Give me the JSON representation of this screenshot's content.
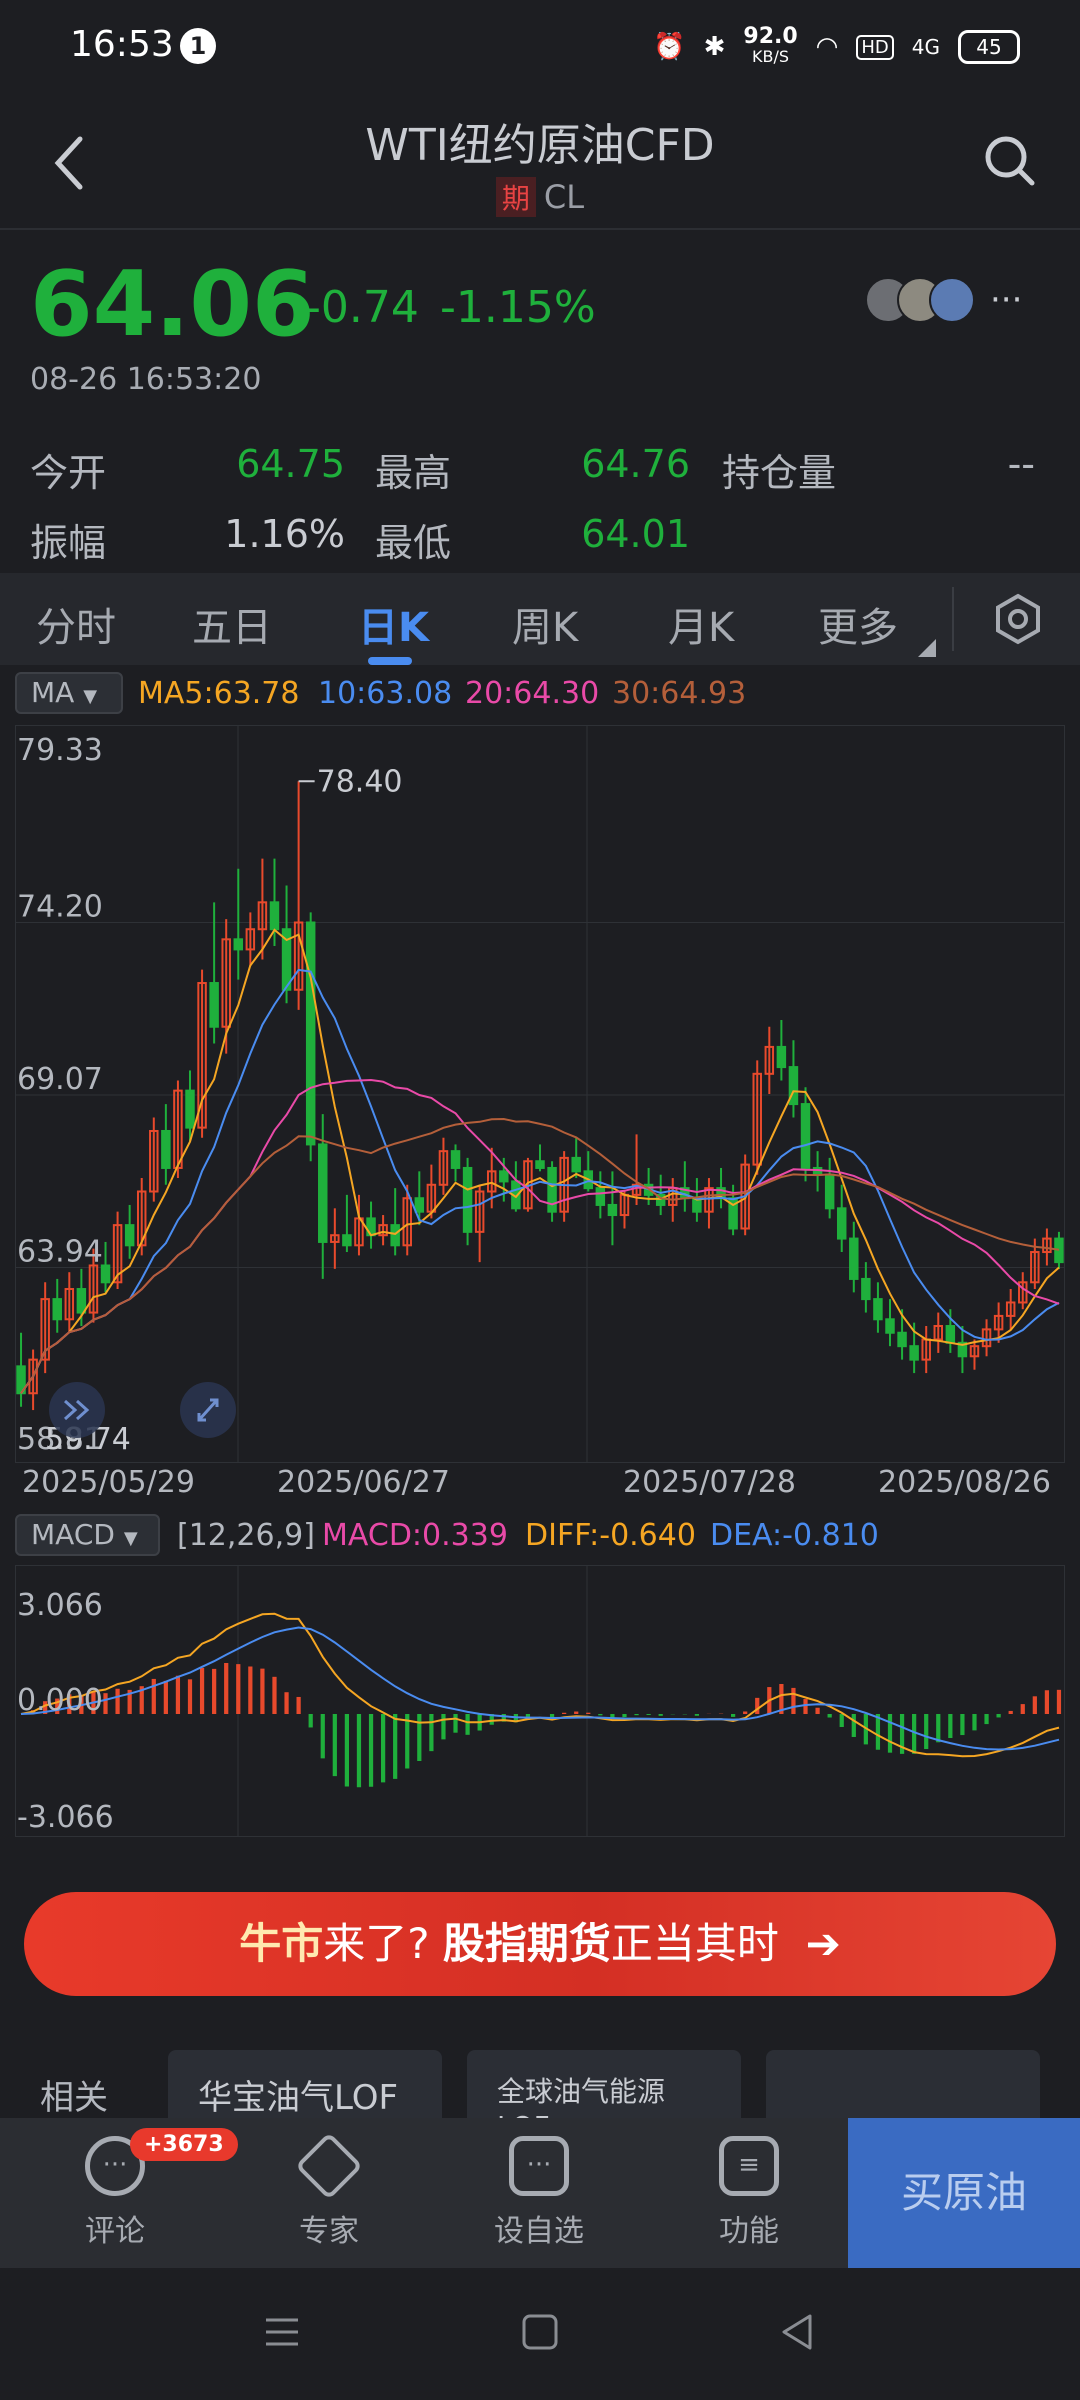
{
  "status_bar": {
    "time": "16:53",
    "notification_count": "1",
    "net_speed": "92.0",
    "net_unit": "KB/S",
    "hd": "HD",
    "signal": "4G",
    "battery": "45"
  },
  "header": {
    "title": "WTI纽约原油CFD",
    "tag": "期",
    "code": "CL"
  },
  "quote": {
    "price": "64.06",
    "change": "-0.74",
    "change_pct": "-1.15%",
    "datetime": "08-26 16:53:20",
    "more": "···",
    "stats": {
      "open_label": "今开",
      "open_value": "64.75",
      "high_label": "最高",
      "high_value": "64.76",
      "oi_label": "持仓量",
      "oi_value": "--",
      "amp_label": "振幅",
      "amp_value": "1.16%",
      "low_label": "最低",
      "low_value": "64.01"
    }
  },
  "tabs": [
    "分时",
    "五日",
    "日K",
    "周K",
    "月K",
    "更多"
  ],
  "active_tab": "日K",
  "ma_bar": {
    "selector": "MA",
    "ma5": "MA5:63.78",
    "ma10": "10:63.08",
    "ma20": "20:64.30",
    "ma30": "30:64.93"
  },
  "macd_bar": {
    "selector": "MACD",
    "params": "[12,26,9]",
    "macd": "MACD:0.339",
    "diff": "DIFF:-0.640",
    "dea": "DEA:-0.810"
  },
  "colors": {
    "up": "#e84a2c",
    "down": "#1fb03c",
    "ma5": "#f5a623",
    "ma10": "#4a8cf0",
    "ma20": "#e94aa8",
    "ma30": "#b45f3a",
    "accent": "#4a8cf0"
  },
  "chart_data": [
    {
      "type": "candlestick",
      "y_ticks": [
        "79.33",
        "74.20",
        "69.07",
        "63.94",
        "58.81"
      ],
      "ylim": [
        58.81,
        79.33
      ],
      "x_ticks": [
        "2025/05/29",
        "2025/06/27",
        "2025/07/28",
        "2025/08/26"
      ],
      "max_label": "78.40",
      "min_label": "59.74",
      "candles": [
        [
          61.0,
          62.0,
          59.8,
          60.2
        ],
        [
          60.2,
          61.5,
          59.7,
          61.2
        ],
        [
          61.2,
          63.5,
          60.8,
          63.0
        ],
        [
          63.0,
          63.6,
          62.0,
          62.4
        ],
        [
          62.4,
          63.8,
          62.0,
          63.3
        ],
        [
          63.3,
          63.9,
          62.2,
          62.6
        ],
        [
          62.6,
          64.5,
          62.3,
          64.0
        ],
        [
          64.0,
          64.7,
          63.2,
          63.5
        ],
        [
          63.5,
          65.6,
          63.3,
          65.2
        ],
        [
          65.2,
          65.8,
          64.2,
          64.6
        ],
        [
          64.6,
          66.6,
          64.3,
          66.2
        ],
        [
          66.2,
          68.4,
          65.9,
          68.0
        ],
        [
          68.0,
          68.8,
          66.4,
          66.9
        ],
        [
          66.9,
          69.5,
          66.6,
          69.2
        ],
        [
          69.2,
          69.8,
          67.7,
          68.1
        ],
        [
          68.1,
          72.8,
          67.8,
          72.4
        ],
        [
          72.4,
          74.8,
          70.6,
          71.1
        ],
        [
          71.1,
          74.3,
          70.3,
          73.7
        ],
        [
          73.7,
          75.8,
          72.5,
          73.4
        ],
        [
          73.4,
          74.5,
          72.9,
          74.0
        ],
        [
          74.0,
          76.1,
          73.1,
          74.8
        ],
        [
          74.8,
          76.1,
          73.5,
          74.0
        ],
        [
          74.0,
          75.3,
          71.8,
          72.2
        ],
        [
          72.2,
          78.4,
          71.6,
          74.2
        ],
        [
          74.2,
          74.5,
          67.1,
          67.6
        ],
        [
          67.6,
          68.5,
          63.6,
          64.7
        ],
        [
          64.7,
          65.7,
          63.9,
          64.9
        ],
        [
          64.9,
          66.1,
          64.4,
          64.6
        ],
        [
          64.6,
          66.1,
          64.3,
          65.4
        ],
        [
          65.4,
          65.9,
          64.5,
          64.9
        ],
        [
          64.9,
          65.5,
          64.6,
          65.2
        ],
        [
          65.2,
          66.3,
          64.3,
          64.6
        ],
        [
          64.6,
          66.4,
          64.3,
          66.0
        ],
        [
          66.0,
          66.8,
          65.2,
          65.6
        ],
        [
          65.6,
          67.0,
          65.4,
          66.4
        ],
        [
          66.4,
          67.8,
          66.1,
          67.4
        ],
        [
          67.4,
          67.6,
          66.5,
          66.9
        ],
        [
          66.9,
          67.2,
          64.6,
          65.0
        ],
        [
          65.0,
          66.4,
          64.1,
          66.2
        ],
        [
          66.2,
          67.5,
          65.7,
          66.8
        ],
        [
          66.8,
          67.2,
          65.9,
          66.5
        ],
        [
          66.5,
          67.1,
          65.6,
          65.7
        ],
        [
          65.7,
          67.2,
          65.6,
          67.1
        ],
        [
          67.1,
          67.6,
          66.8,
          66.9
        ],
        [
          66.9,
          67.1,
          65.3,
          65.6
        ],
        [
          65.6,
          67.4,
          65.3,
          67.2
        ],
        [
          67.2,
          67.8,
          66.6,
          66.8
        ],
        [
          66.8,
          67.4,
          66.2,
          66.3
        ],
        [
          66.3,
          66.8,
          65.4,
          65.8
        ],
        [
          65.8,
          66.8,
          64.6,
          65.5
        ],
        [
          65.5,
          66.2,
          65.1,
          66.1
        ],
        [
          66.1,
          67.9,
          65.8,
          66.4
        ],
        [
          66.4,
          66.9,
          65.8,
          66.1
        ],
        [
          66.1,
          66.7,
          65.5,
          65.8
        ],
        [
          65.8,
          66.6,
          65.3,
          66.3
        ],
        [
          66.3,
          67.1,
          65.6,
          66.0
        ],
        [
          66.0,
          66.6,
          65.3,
          65.6
        ],
        [
          65.6,
          66.6,
          65.1,
          66.3
        ],
        [
          66.3,
          66.9,
          65.7,
          66.0
        ],
        [
          66.0,
          66.4,
          64.9,
          65.1
        ],
        [
          65.1,
          67.3,
          64.9,
          67.0
        ],
        [
          67.0,
          70.1,
          66.7,
          69.7
        ],
        [
          69.7,
          71.1,
          69.1,
          70.5
        ],
        [
          70.5,
          71.3,
          69.5,
          69.9
        ],
        [
          69.9,
          70.7,
          68.4,
          68.8
        ],
        [
          68.8,
          69.3,
          66.5,
          66.9
        ],
        [
          66.9,
          67.4,
          66.2,
          66.7
        ],
        [
          66.7,
          67.2,
          65.4,
          65.7
        ],
        [
          65.7,
          66.4,
          64.4,
          64.8
        ],
        [
          64.8,
          65.3,
          63.2,
          63.6
        ],
        [
          63.6,
          64.1,
          62.6,
          63.0
        ],
        [
          63.0,
          63.5,
          62.0,
          62.4
        ],
        [
          62.4,
          63.0,
          61.6,
          62.0
        ],
        [
          62.0,
          62.7,
          61.2,
          61.6
        ],
        [
          61.6,
          62.3,
          60.8,
          61.2
        ],
        [
          61.2,
          62.2,
          60.8,
          61.8
        ],
        [
          61.8,
          62.6,
          61.4,
          62.2
        ],
        [
          62.2,
          62.7,
          61.4,
          61.7
        ],
        [
          61.7,
          62.2,
          60.8,
          61.3
        ],
        [
          61.3,
          61.8,
          60.9,
          61.6
        ],
        [
          61.6,
          62.4,
          61.3,
          62.1
        ],
        [
          62.1,
          62.9,
          61.7,
          62.5
        ],
        [
          62.5,
          63.3,
          62.1,
          62.9
        ],
        [
          62.9,
          63.8,
          62.7,
          63.5
        ],
        [
          63.5,
          64.8,
          63.3,
          64.4
        ],
        [
          64.4,
          65.1,
          64.0,
          64.8
        ],
        [
          64.8,
          65.0,
          63.9,
          64.1
        ]
      ],
      "series": [
        {
          "name": "MA5",
          "color": "#f5a623"
        },
        {
          "name": "10",
          "color": "#4a8cf0"
        },
        {
          "name": "20",
          "color": "#e94aa8"
        },
        {
          "name": "30",
          "color": "#b45f3a"
        }
      ]
    },
    {
      "type": "macd",
      "y_ticks": [
        "3.066",
        "0.000",
        "-3.066"
      ],
      "ylim": [
        -3.066,
        3.066
      ],
      "params": "[12,26,9]",
      "series": [
        {
          "name": "MACD",
          "color": "#e94aa8"
        },
        {
          "name": "DIFF",
          "color": "#f5a623"
        },
        {
          "name": "DEA",
          "color": "#4a8cf0"
        }
      ]
    }
  ],
  "banner": {
    "part1": "牛市",
    "part2": "来了?",
    "part3": "股指期货",
    "part4": "正当其时",
    "arrow": "➔"
  },
  "peek": {
    "label": "相关",
    "card1": "华宝油气LOF",
    "card2": "全球油气能源LOF"
  },
  "bottom_nav": {
    "comment_label": "评论",
    "comment_badge": "+3673",
    "expert_label": "专家",
    "watch_label": "设自选",
    "func_label": "功能",
    "buy_label": "买原油"
  }
}
